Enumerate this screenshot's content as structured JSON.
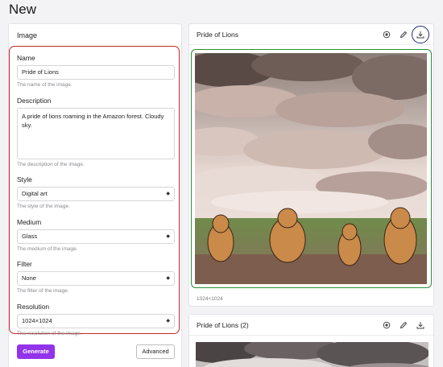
{
  "page": {
    "title": "New"
  },
  "form": {
    "card_title": "Image",
    "name": {
      "label": "Name",
      "value": "Pride of Lions",
      "help": "The name of the image."
    },
    "description": {
      "label": "Description",
      "value": "A pride of lions roaming in the Amazon forest. Cloudy sky.",
      "help": "The description of the image."
    },
    "style": {
      "label": "Style",
      "value": "Digital art",
      "help": "The style of the image."
    },
    "medium": {
      "label": "Medium",
      "value": "Glass",
      "help": "The medium of the image."
    },
    "filter": {
      "label": "Filter",
      "value": "None",
      "help": "The filter of the image."
    },
    "resolution": {
      "label": "Resolution",
      "value": "1024×1024",
      "help": "The resolution of the image."
    },
    "generate_label": "Generate",
    "advanced_label": "Advanced"
  },
  "results": [
    {
      "title": "Pride of Lions",
      "resolution": "1024×1024"
    },
    {
      "title": "Pride of Lions (2)"
    }
  ],
  "icons": [
    "view-icon",
    "edit-icon",
    "download-icon"
  ],
  "colors": {
    "accent": "#9333ea",
    "highlight_red": "#c6262e",
    "highlight_green": "#2e8f3a",
    "highlight_blue": "#1e2a78"
  }
}
